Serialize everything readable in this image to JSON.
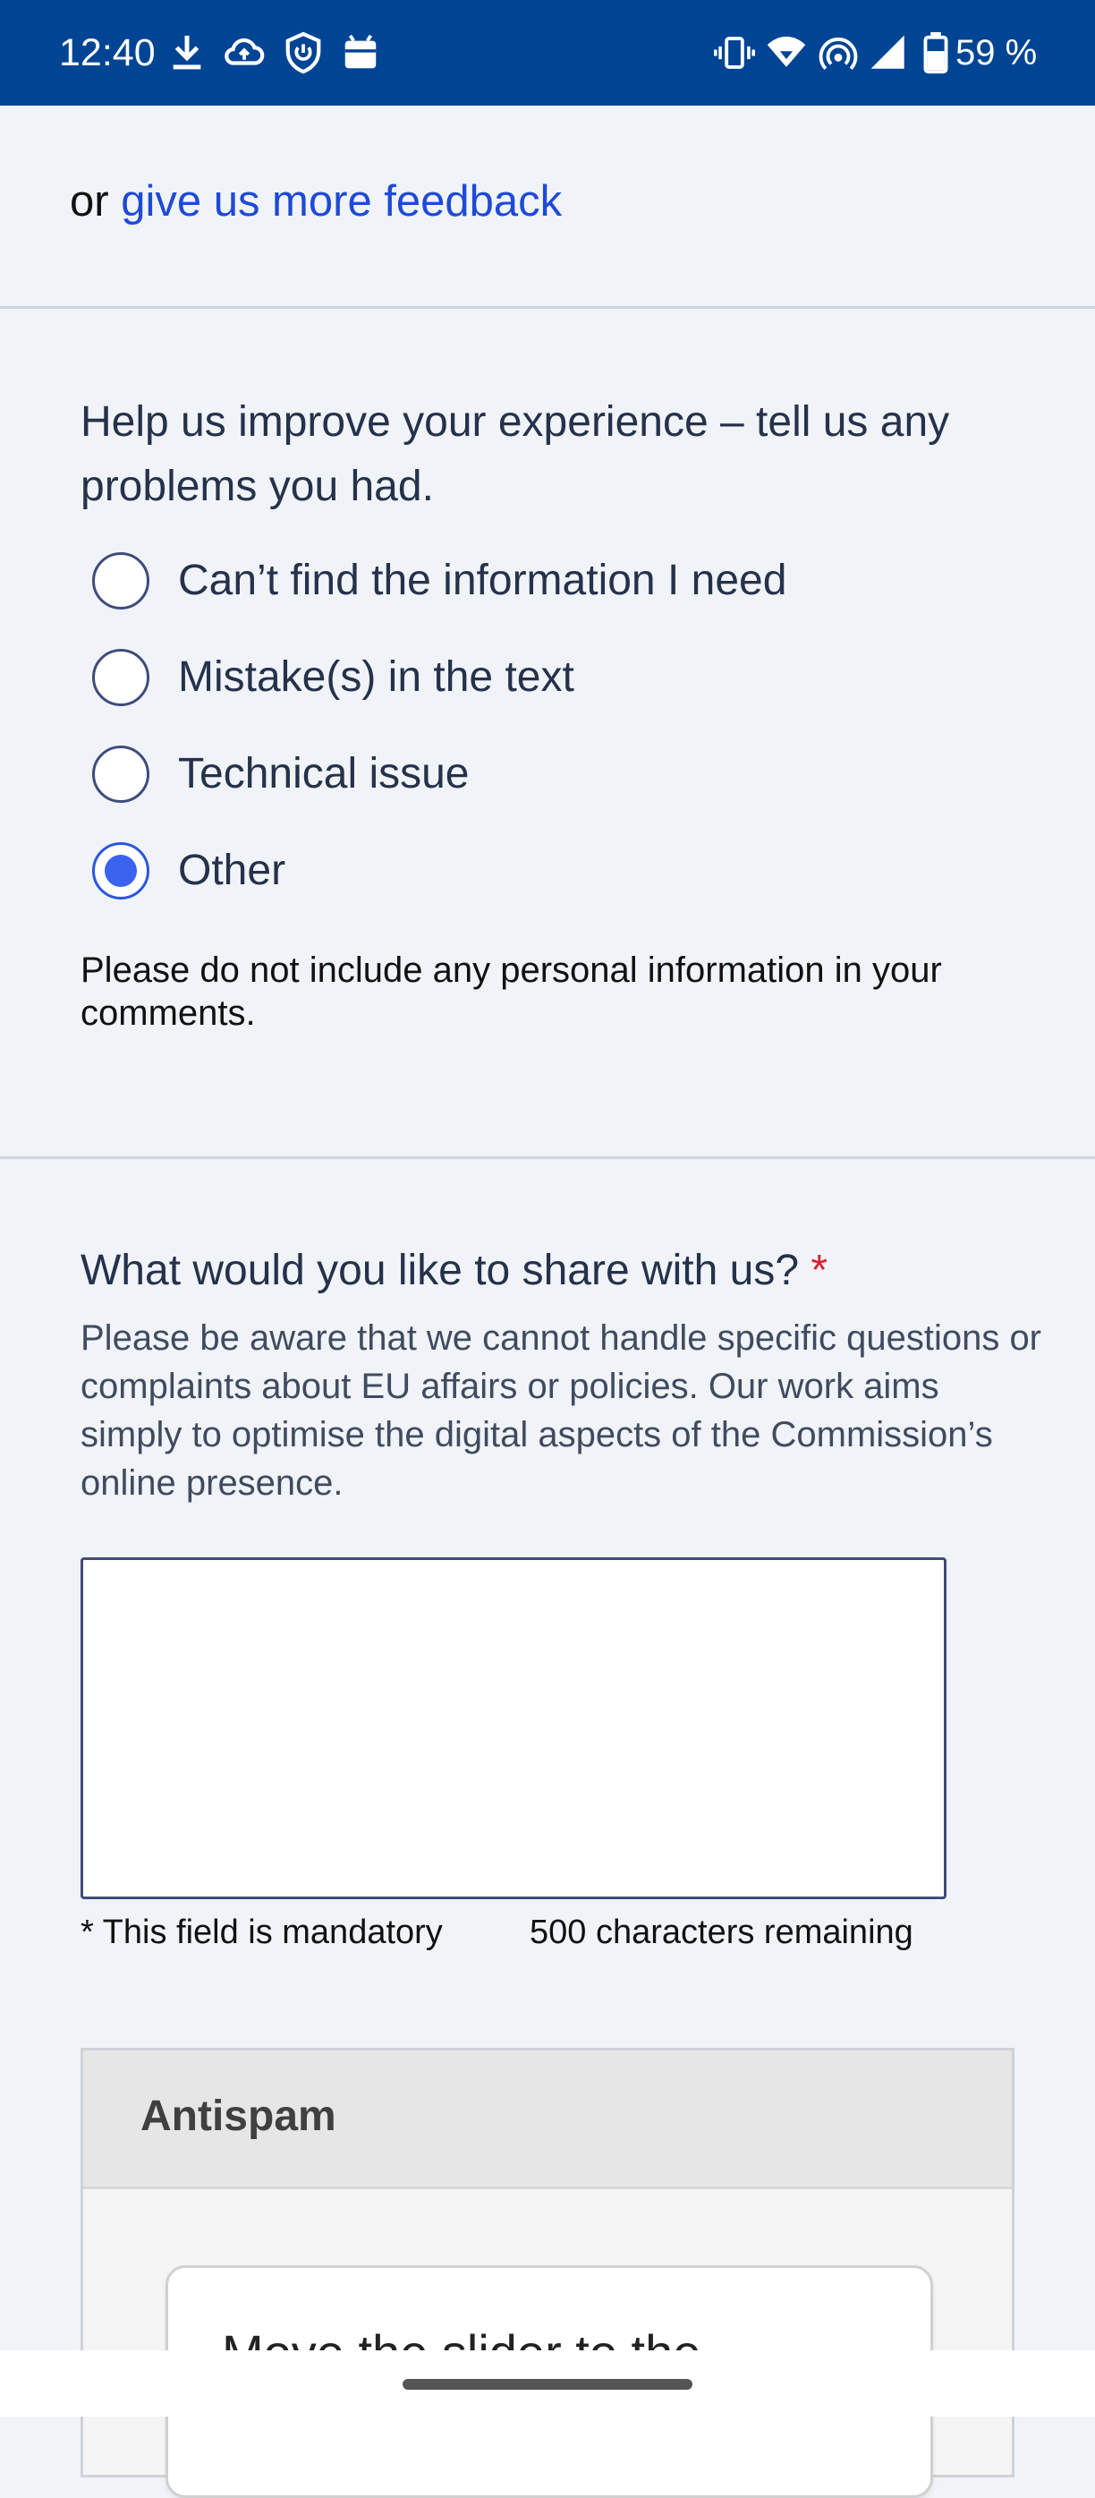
{
  "status_bar": {
    "time": "12:40",
    "battery_percent": "59 %",
    "icons": [
      "download-icon",
      "cloud-upload-icon",
      "shield-icon",
      "android-icon",
      "vibrate-icon",
      "wifi-icon",
      "hotspot-icon",
      "cell-signal-icon",
      "battery-icon"
    ]
  },
  "feedback": {
    "prefix": "or ",
    "link_text": "give us more feedback"
  },
  "problems": {
    "question": "Help us improve your experience – tell us any problems you had.",
    "options": [
      {
        "label": "Can’t find the information I need",
        "checked": false
      },
      {
        "label": "Mistake(s) in the text",
        "checked": false
      },
      {
        "label": "Technical issue",
        "checked": false
      },
      {
        "label": "Other",
        "checked": true
      }
    ],
    "privacy_note": "Please do not include any personal information in your comments."
  },
  "share": {
    "question": "What would you like to share with us?",
    "required_marker": "*",
    "help_text": "Please be aware that we cannot handle specific questions or complaints about EU affairs or policies. Our work aims simply to optimise the digital aspects of the Commission’s online presence.",
    "value": "",
    "mandatory_note": "* This field is mandatory",
    "chars_remaining": "500 characters remaining"
  },
  "antispam": {
    "title": "Antispam",
    "slider_instruction": "Move the slider to the"
  },
  "colors": {
    "status_bar": "#004494",
    "link": "#1e4ad6",
    "radio_selected": "#3a63f0",
    "required": "#da2131",
    "page_bg": "#f0f4f9"
  }
}
